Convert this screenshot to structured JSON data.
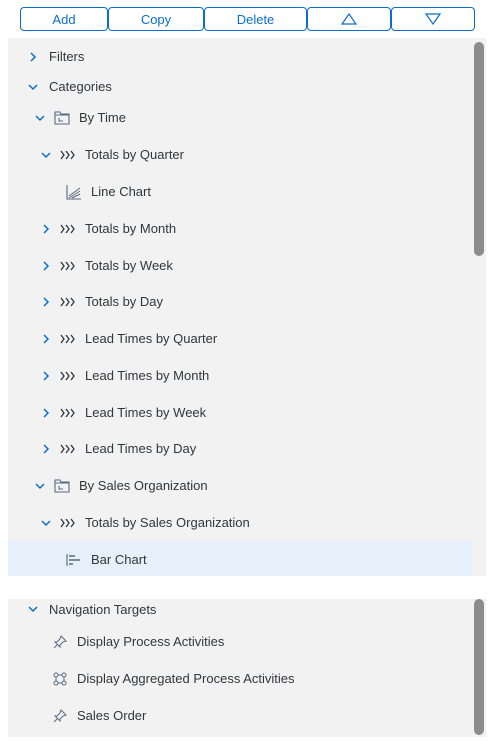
{
  "toolbar": {
    "add_label": "Add",
    "copy_label": "Copy",
    "delete_label": "Delete",
    "move_up_icon": "triangle-up-icon",
    "move_down_icon": "triangle-down-icon"
  },
  "tree": {
    "filters": "Filters",
    "categories": "Categories",
    "by_time": "By Time",
    "totals_by_quarter": "Totals by Quarter",
    "line_chart": "Line Chart",
    "totals_by_month": "Totals by Month",
    "totals_by_week": "Totals by Week",
    "totals_by_day": "Totals by Day",
    "lead_times_by_quarter": "Lead Times by Quarter",
    "lead_times_by_month": "Lead Times by Month",
    "lead_times_by_week": "Lead Times by Week",
    "lead_times_by_day": "Lead Times by Day",
    "by_sales_organization": "By Sales Organization",
    "totals_by_sales_organization": "Totals by Sales Organization",
    "bar_chart": "Bar Chart"
  },
  "navigation": {
    "header": "Navigation Targets",
    "items": [
      {
        "label": "Display Process Activities",
        "icon": "pin-icon"
      },
      {
        "label": "Display Aggregated Process Activities",
        "icon": "network-icon"
      },
      {
        "label": "Sales Order",
        "icon": "pin-icon"
      }
    ]
  },
  "colors": {
    "accent": "#0a6ed1",
    "selected_row": "#e5f0fa",
    "panel_bg": "#f2f2f2"
  }
}
